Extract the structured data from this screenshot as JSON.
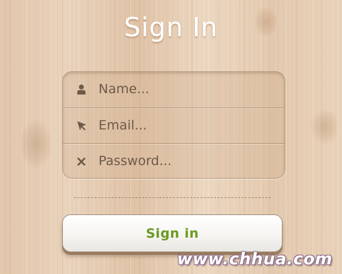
{
  "title": "Sign In",
  "fields": [
    {
      "icon": "user-icon",
      "placeholder": "Name...",
      "value": ""
    },
    {
      "icon": "cursor-arrow-icon",
      "placeholder": "Email...",
      "value": ""
    },
    {
      "icon": "x-icon",
      "placeholder": "Password...",
      "value": ""
    }
  ],
  "button": {
    "label": "Sign in",
    "color": "#6a9a1f"
  },
  "watermark": "www.chhua.com",
  "colors": {
    "field_text": "#6e5a48",
    "icon": "#6e5a48",
    "title": "#ffffff"
  }
}
